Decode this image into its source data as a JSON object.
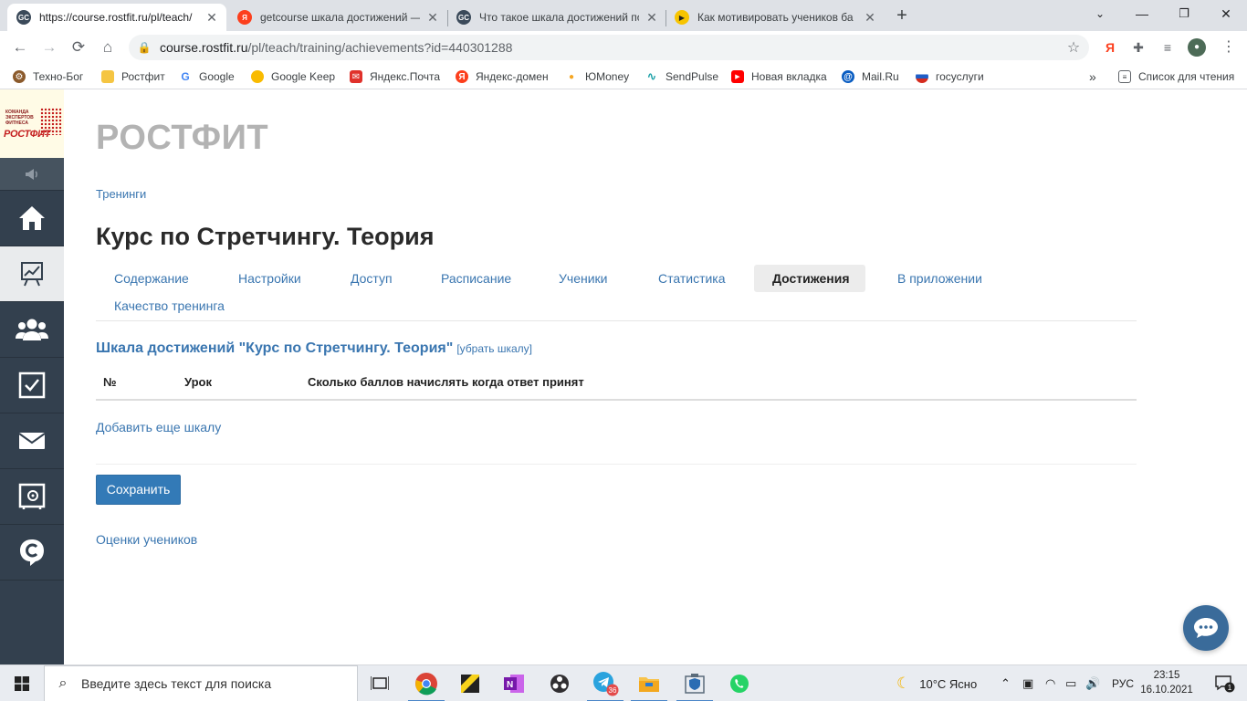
{
  "browser": {
    "tabs": [
      {
        "title": "https://course.rostfit.ru/pl/teach/",
        "favicon": "GC",
        "color": "#3b4a5a",
        "active": true
      },
      {
        "title": "getcourse шкала достижений —",
        "favicon": "Я",
        "color": "#fc3f1d",
        "active": false
      },
      {
        "title": "Что такое шкала достижений по",
        "favicon": "GC",
        "color": "#3b4a5a",
        "active": false
      },
      {
        "title": "Как мотивировать учеников ба",
        "favicon": "▶",
        "color": "#f7c400",
        "active": false
      }
    ],
    "url_host": "course.rostfit.ru",
    "url_path": "/pl/teach/training/achievements?id=440301288",
    "bookmarks": [
      {
        "label": "Техно-Бог",
        "icon": "gear-icon",
        "color": "#8b5a2b"
      },
      {
        "label": "Ростфит",
        "icon": "folder-icon",
        "color": "#f5c542"
      },
      {
        "label": "Google",
        "icon": "google-icon",
        "color": "#4285f4"
      },
      {
        "label": "Google Keep",
        "icon": "keep-icon",
        "color": "#f9bb00"
      },
      {
        "label": "Яндекс.Почта",
        "icon": "mail-icon",
        "color": "#e0312b"
      },
      {
        "label": "Яндекс-домен",
        "icon": "yandex-icon",
        "color": "#fc3f1d"
      },
      {
        "label": "ЮMoney",
        "icon": "money-icon",
        "color": "#f5a623"
      },
      {
        "label": "SendPulse",
        "icon": "pulse-icon",
        "color": "#19a0a7"
      },
      {
        "label": "Новая вкладка",
        "icon": "youtube-icon",
        "color": "#ff0000"
      },
      {
        "label": "Mail.Ru",
        "icon": "at-icon",
        "color": "#0a5dc2"
      },
      {
        "label": "госуслуги",
        "icon": "flag-icon",
        "color": "#1f5dc6"
      }
    ],
    "reading_list": "Список для чтения"
  },
  "page": {
    "brand": "РОСТФИТ",
    "logo_small_text": "КОМАНДА ЭКСПЕРТОВ ФИТНЕСА",
    "logo_text": "РОСТФИТ",
    "breadcrumb": "Тренинги",
    "title": "Курс по Стретчингу. Теория",
    "tabs": [
      {
        "label": "Содержание"
      },
      {
        "label": "Настройки"
      },
      {
        "label": "Доступ"
      },
      {
        "label": "Расписание"
      },
      {
        "label": "Ученики"
      },
      {
        "label": "Статистика"
      },
      {
        "label": "Достижения",
        "active": true
      },
      {
        "label": "В приложении"
      },
      {
        "label": "Качество тренинга"
      }
    ],
    "scale_title": "Шкала достижений \"Курс по Стретчингу. Теория\"",
    "scale_remove": "[убрать шкалу]",
    "table_headers": [
      "№",
      "Урок",
      "Сколько баллов начислять когда ответ принят"
    ],
    "add_scale": "Добавить еще шкалу",
    "save_button": "Сохранить",
    "student_grades": "Оценки учеников"
  },
  "taskbar": {
    "search_placeholder": "Введите здесь текст для поиска",
    "weather": "10°C  Ясно",
    "lang": "РУС",
    "time": "23:15",
    "date": "16.10.2021",
    "telegram_badge": "36",
    "notifications": "1"
  }
}
